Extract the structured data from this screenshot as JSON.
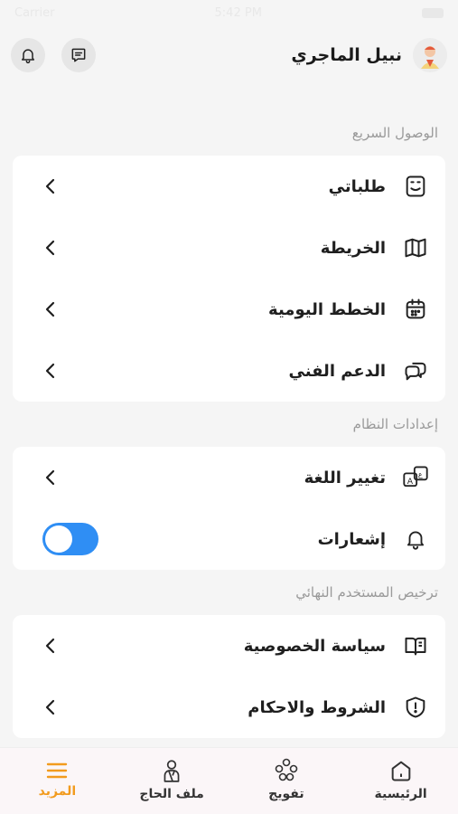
{
  "status_bar": {
    "carrier": "Carrier",
    "time": "5:42 PM"
  },
  "header": {
    "user_name": "نبيل الماجري"
  },
  "sections": {
    "quick_access": {
      "title": "الوصول السريع",
      "items": [
        {
          "label": "طلباتي",
          "icon": "requests-icon"
        },
        {
          "label": "الخريطة",
          "icon": "map-icon"
        },
        {
          "label": "الخطط اليومية",
          "icon": "calendar-icon"
        },
        {
          "label": "الدعم الفني",
          "icon": "support-chat-icon"
        }
      ]
    },
    "system_settings": {
      "title": "إعدادات النظام",
      "items": [
        {
          "label": "تغيير اللغة",
          "icon": "language-icon"
        },
        {
          "label": "إشعارات",
          "icon": "bell-icon",
          "toggle_on": true
        }
      ]
    },
    "end_user_license": {
      "title": "ترخيص المستخدم النهائي",
      "items": [
        {
          "label": "سياسة الخصوصية",
          "icon": "book-icon"
        },
        {
          "label": "الشروط والاحكام",
          "icon": "shield-alert-icon"
        }
      ]
    }
  },
  "tabbar": {
    "tabs": [
      {
        "label": "المزيد",
        "icon": "menu-icon",
        "active": true
      },
      {
        "label": "ملف الحاج",
        "icon": "pilgrim-profile-icon",
        "active": false
      },
      {
        "label": "تفويج",
        "icon": "group-icon",
        "active": false
      },
      {
        "label": "الرئيسية",
        "icon": "home-icon",
        "active": false
      }
    ]
  },
  "colors": {
    "accent": "#f29b1e",
    "toggle": "#2f8ef4",
    "background": "#f5f5f5"
  }
}
